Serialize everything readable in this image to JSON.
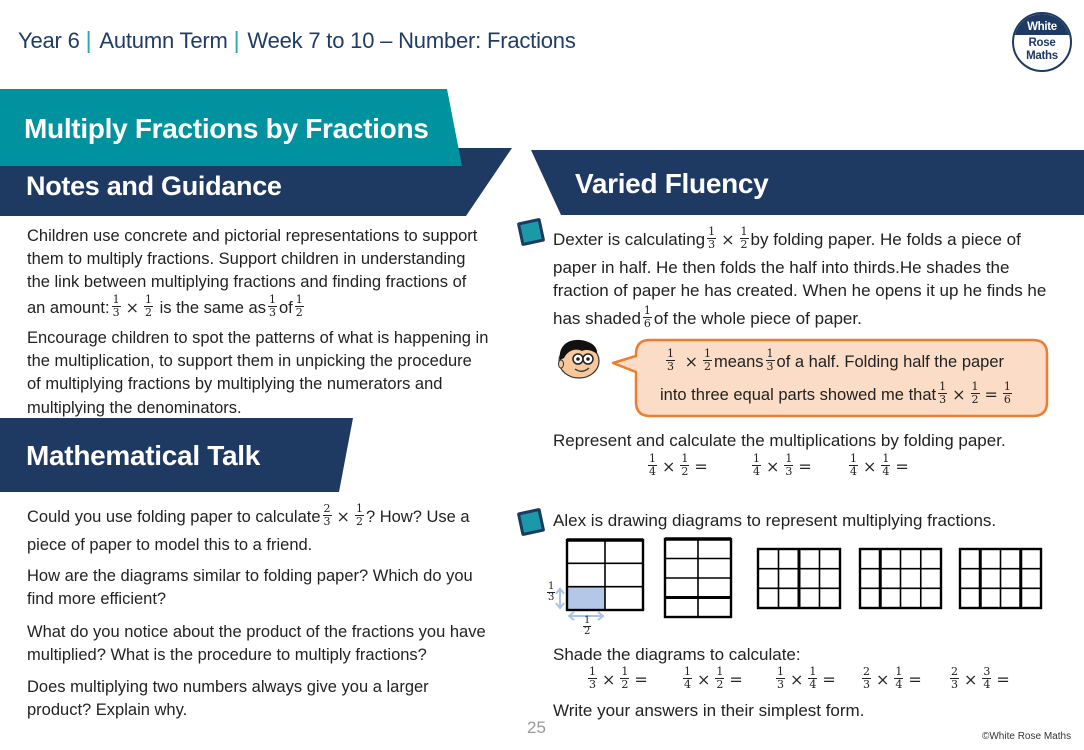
{
  "header": {
    "year": "Year 6",
    "separator": "|",
    "term": "Autumn Term",
    "unit": "Week 7 to 10 – Number: Fractions"
  },
  "logo": {
    "word1": "White",
    "word2": "Rose",
    "word3": "Maths"
  },
  "symbols": {
    "times": "×",
    "equals": "="
  },
  "lesson_title": "Multiply Fractions by Fractions",
  "colors": {
    "navy": "#1e3a63",
    "teal": "#00929f",
    "speech_border": "#ed7d31",
    "speech_fill": "#fbdcc6",
    "shade": "#b4c7e7"
  },
  "notes": {
    "heading": "Notes and Guidance",
    "line1": "Children use concrete and pictorial representations to support",
    "line2": "them to multiply fractions. Support children in understanding",
    "line3": "the link between multiplying fractions and finding fractions of",
    "line4": {
      "text_a": "an amount:",
      "frac_a": {
        "n": "1",
        "d": "3"
      },
      "frac_b": {
        "n": "1",
        "d": "2"
      },
      "text_b": "is the same as",
      "frac_c": {
        "n": "1",
        "d": "3"
      },
      "text_c": "of",
      "frac_d": {
        "n": "1",
        "d": "2"
      }
    },
    "line5": "Encourage children to spot the patterns of what is happening in",
    "line6": "the multiplication, to support them in unpicking the procedure",
    "line7": "of multiplying fractions by multiplying the numerators and",
    "line8": "multiplying the denominators."
  },
  "math_talk": {
    "heading": "Mathematical Talk",
    "q1": {
      "text_a": "Could you use folding paper to calculate",
      "frac_a": {
        "n": "2",
        "d": "3"
      },
      "frac_b": {
        "n": "1",
        "d": "2"
      },
      "text_b": "? How? Use a",
      "line2": "piece of paper to model this to a friend."
    },
    "q2": {
      "line1": "How are the diagrams similar to folding paper? Which do you",
      "line2": "find more efficient?"
    },
    "q3": {
      "line1": "What do you notice about the product of the fractions you have",
      "line2": "multiplied? What is the procedure to multiply fractions?"
    },
    "q4": {
      "line1": "Does multiplying two numbers always give you a larger",
      "line2": "product? Explain why."
    }
  },
  "varied_fluency": {
    "heading": "Varied Fluency",
    "q1": {
      "line1": {
        "text_a": "Dexter is calculating",
        "frac_a": {
          "n": "1",
          "d": "3"
        },
        "frac_b": {
          "n": "1",
          "d": "2"
        },
        "text_b": "by folding paper. He folds a piece of"
      },
      "line2": "paper in half. He then folds the half into thirds.He shades the",
      "line3": "fraction of paper he has created. When he opens it up he finds he",
      "line4": {
        "text_a": "has shaded",
        "frac_a": {
          "n": "1",
          "d": "6"
        },
        "text_b": "of the whole piece of paper."
      },
      "speech": {
        "line1": {
          "frac_a": {
            "n": "1",
            "d": "3"
          },
          "frac_b": {
            "n": "1",
            "d": "2"
          },
          "text_a": "means",
          "frac_c": {
            "n": "1",
            "d": "3"
          },
          "text_b": "of a half. Folding half the paper"
        },
        "line2": {
          "text_a": "into three equal parts showed me that",
          "frac_a": {
            "n": "1",
            "d": "3"
          },
          "frac_b": {
            "n": "1",
            "d": "2"
          },
          "frac_c": {
            "n": "1",
            "d": "6"
          }
        }
      },
      "instruction": "Represent and calculate the multiplications by folding paper.",
      "calculations": [
        {
          "a": {
            "n": "1",
            "d": "4"
          },
          "b": {
            "n": "1",
            "d": "2"
          }
        },
        {
          "a": {
            "n": "1",
            "d": "4"
          },
          "b": {
            "n": "1",
            "d": "3"
          }
        },
        {
          "a": {
            "n": "1",
            "d": "4"
          },
          "b": {
            "n": "1",
            "d": "4"
          }
        }
      ]
    },
    "q2": {
      "intro": "Alex is drawing diagrams to represent multiplying fractions.",
      "diagrams": [
        {
          "rows": 3,
          "cols": 2,
          "shaded_cells": [
            [
              2,
              0
            ]
          ],
          "bold_row_dividers": [],
          "bold_col_dividers": [],
          "row_label": {
            "n": "1",
            "d": "3"
          },
          "col_label": {
            "n": "1",
            "d": "2"
          }
        },
        {
          "rows": 4,
          "cols": 2,
          "shaded_cells": [],
          "bold_row_dividers": [
            3
          ],
          "bold_col_dividers": []
        },
        {
          "rows": 3,
          "cols": 4,
          "shaded_cells": [],
          "bold_row_dividers": [],
          "bold_col_dividers": [
            2
          ]
        },
        {
          "rows": 3,
          "cols": 4,
          "shaded_cells": [],
          "bold_row_dividers": [],
          "bold_col_dividers": [
            1
          ]
        },
        {
          "rows": 3,
          "cols": 4,
          "shaded_cells": [],
          "bold_row_dividers": [],
          "bold_col_dividers": [
            1,
            3
          ]
        }
      ],
      "instruction": "Shade the diagrams to calculate:",
      "calculations": [
        {
          "a": {
            "n": "1",
            "d": "3"
          },
          "b": {
            "n": "1",
            "d": "2"
          }
        },
        {
          "a": {
            "n": "1",
            "d": "4"
          },
          "b": {
            "n": "1",
            "d": "2"
          }
        },
        {
          "a": {
            "n": "1",
            "d": "3"
          },
          "b": {
            "n": "1",
            "d": "4"
          }
        },
        {
          "a": {
            "n": "2",
            "d": "3"
          },
          "b": {
            "n": "1",
            "d": "4"
          }
        },
        {
          "a": {
            "n": "2",
            "d": "3"
          },
          "b": {
            "n": "3",
            "d": "4"
          }
        }
      ],
      "note": "Write your answers in their simplest form."
    }
  },
  "footer": {
    "page_number": "25",
    "copyright": "©White Rose Maths"
  }
}
